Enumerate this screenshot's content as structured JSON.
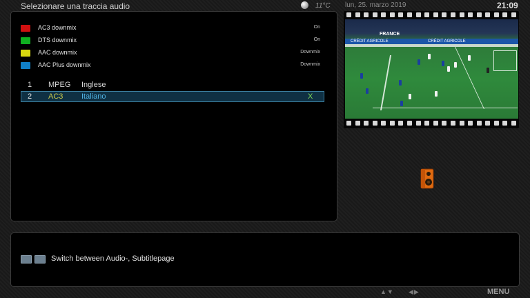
{
  "header": {
    "title": "Selezionare una traccia audio",
    "temperature": "11°C",
    "date": "lun, 25. marzo 2019",
    "time": "21:09"
  },
  "color_buttons": [
    {
      "color": "#d01010",
      "label": "AC3 downmix",
      "value": "On"
    },
    {
      "color": "#10b020",
      "label": "DTS downmix",
      "value": "On"
    },
    {
      "color": "#d8d810",
      "label": "AAC downmix",
      "value": "Downmix"
    },
    {
      "color": "#1080c8",
      "label": "AAC Plus downmix",
      "value": "Downmix"
    }
  ],
  "tracks": [
    {
      "num": "1",
      "codec": "MPEG",
      "language": "Inglese",
      "mark": ""
    },
    {
      "num": "2",
      "codec": "AC3",
      "language": "Italiano",
      "mark": "X"
    }
  ],
  "preview": {
    "board_text": "FRANCE",
    "sponsor_text": "CRÉDIT AGRICOLE"
  },
  "hint": {
    "text": "Switch between Audio-, Subtitlepage"
  },
  "footer": {
    "updown": "▲▼",
    "leftright": "◀▶",
    "menu": "MENU"
  }
}
